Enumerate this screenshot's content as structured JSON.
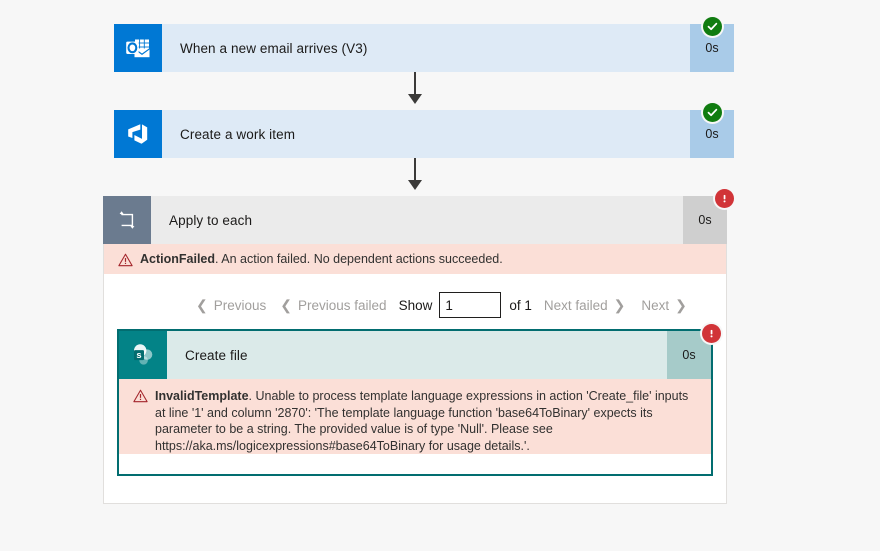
{
  "flow": {
    "steps": [
      {
        "id": "trigger-email",
        "title": "When a new email arrives (V3)",
        "duration": "0s",
        "status": "succeeded",
        "icon": "outlook-icon"
      },
      {
        "id": "create-work-item",
        "title": "Create a work item",
        "duration": "0s",
        "status": "succeeded",
        "icon": "azure-devops-icon"
      },
      {
        "id": "apply-to-each",
        "title": "Apply to each",
        "duration": "0s",
        "status": "failed",
        "icon": "loop-icon"
      },
      {
        "id": "create-file",
        "title": "Create file",
        "duration": "0s",
        "status": "failed",
        "icon": "sharepoint-icon"
      }
    ]
  },
  "errors": {
    "scope": {
      "code": "ActionFailed",
      "message": ". An action failed. No dependent actions succeeded.",
      "icon": "warning-triangle-icon"
    },
    "action": {
      "code": "InvalidTemplate",
      "message": ". Unable to process template language expressions in action 'Create_file' inputs at line '1' and column '2870': 'The template language function 'base64ToBinary' expects its parameter to be a string. The provided value is of type 'Null'. Please see https://aka.ms/logicexpressions#base64ToBinary for usage details.'.",
      "icon": "warning-triangle-icon"
    }
  },
  "pagination": {
    "previous_label": "Previous",
    "previous_failed_label": "Previous failed",
    "show_label": "Show",
    "current_page": "1",
    "page_placeholder": "1",
    "of_label": "of 1",
    "next_failed_label": "Next failed",
    "next_label": "Next",
    "chevron_left": "❮",
    "chevron_right": "❯"
  },
  "colors": {
    "success": "#107c10",
    "error": "#d13438",
    "outlook_blue": "#0078d4",
    "sharepoint_teal": "#038387",
    "loop_gray": "#6b7b8f",
    "error_banner_bg": "#fbdfd7",
    "selected_border": "#026d70"
  }
}
